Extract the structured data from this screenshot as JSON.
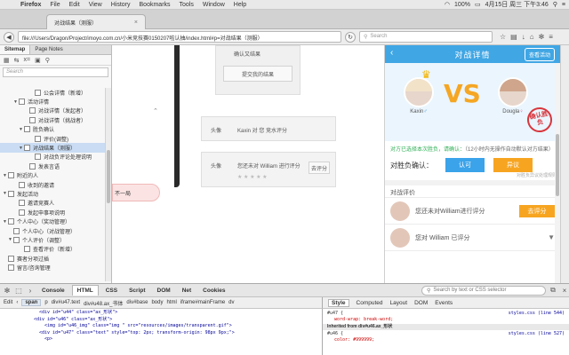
{
  "menubar": {
    "app": "Firefox",
    "items": [
      "File",
      "Edit",
      "View",
      "History",
      "Bookmarks",
      "Tools",
      "Window",
      "Help"
    ],
    "battery": "100%",
    "clock": "4月15日 周三 下午3:46"
  },
  "tab": {
    "title": "对战结果（测服）"
  },
  "nav": {
    "url": "file:///Users/Dragon/Project/imoyo.com.cn/小米竞技赛0150207啦认抽/index.html#p=对战结果（测服）",
    "search_placeholder": "Search"
  },
  "sidebar": {
    "tabs": [
      "Sitemap",
      "Page Notes"
    ],
    "search_placeholder": "Search",
    "tree": [
      {
        "label": "公会详情（新增）",
        "indent": 5,
        "type": "page"
      },
      {
        "label": "活动详情",
        "indent": 2,
        "type": "folder"
      },
      {
        "label": "对战详情（发起者）",
        "indent": 4,
        "type": "page"
      },
      {
        "label": "对战详情（挑战者）",
        "indent": 4,
        "type": "page"
      },
      {
        "label": "胜负确认",
        "indent": 3,
        "type": "folder"
      },
      {
        "label": "评价(调整)",
        "indent": 5,
        "type": "page"
      },
      {
        "label": "对战结果（测服）",
        "indent": 3,
        "type": "folder",
        "selected": true
      },
      {
        "label": "对战负评论处理说明",
        "indent": 5,
        "type": "page"
      },
      {
        "label": "发表言语",
        "indent": 4,
        "type": "page"
      },
      {
        "label": "附近的人",
        "indent": 0,
        "type": "folder"
      },
      {
        "label": "收到的邀请",
        "indent": 2,
        "type": "page"
      },
      {
        "label": "发起活动",
        "indent": 0,
        "type": "folder"
      },
      {
        "label": "邀请竞赛人",
        "indent": 2,
        "type": "page"
      },
      {
        "label": "发起申事项说明",
        "indent": 2,
        "type": "page"
      },
      {
        "label": "个人中心（奖动管理）",
        "indent": 0,
        "type": "folder"
      },
      {
        "label": "个人中心（对战管理）",
        "indent": 1,
        "type": "page"
      },
      {
        "label": "个人评价（调整）",
        "indent": 1,
        "type": "folder"
      },
      {
        "label": "查看评价（新增）",
        "indent": 3,
        "type": "page"
      },
      {
        "label": "赛者分项过插",
        "indent": 0,
        "type": "page"
      },
      {
        "label": "留言/咨询管理",
        "indent": 0,
        "type": "page"
      }
    ]
  },
  "canvas": {
    "top_card_text": "确认又结果",
    "top_card_button": "提交我的结果",
    "row1_label": "头像",
    "row1_text": "Kaxin 对 您 竞水评分",
    "row2_label": "头像",
    "row2_text": "您还未对 William 进行评分",
    "row2_button": "去评分",
    "pink_pill": "不一局"
  },
  "phone": {
    "title": "对战详情",
    "action": "查看活动",
    "player1": {
      "name": "Kaxin",
      "sex": "♂"
    },
    "player2": {
      "name": "Dougla",
      "sex": "♀"
    },
    "vs": "VS",
    "stamp": "确认胜负",
    "notice_green": "对方已选择本次胜负，请确认：",
    "notice_grey": "（12小时内无操作自动默认对方结果）",
    "confirm_label": "对胜负确认：",
    "btn_agree": "认可",
    "btn_dispute": "异议",
    "small_link": "对胜负异议处理规则",
    "eval_title": "对战评价",
    "eval1_text": "您还未对William进行评分",
    "eval1_button": "去评分",
    "eval2_text": "您对 William 已评分",
    "eval2_arrow": "▼"
  },
  "firebug": {
    "tabs": [
      "Console",
      "HTML",
      "CSS",
      "Script",
      "DOM",
      "Net",
      "Cookies"
    ],
    "active_tab": "HTML",
    "search_placeholder": "Search by text or CSS selector",
    "edit_label": "Edit",
    "crumbs": [
      "span",
      "p",
      "div#u47.text",
      "div#u48.ax_书体",
      "div#base",
      "body",
      "html",
      "iframe#mainFrame",
      "dv"
    ],
    "selected_crumb": "span",
    "side_tabs": [
      "Style",
      "Computed",
      "Layout",
      "DOM",
      "Events"
    ],
    "html_lines": [
      "<div id=\"u44\" class=\"ax_形状\">",
      "<div id=\"u46\" class=\"ax_形状\">",
      "<img id=\"u46_img\" class=\"img \" src=\"resources/images/transparent.gif\">",
      "<div id=\"u47\" class=\"text\" style=\"top: 2px; transform-origin: 98px 9px;\">",
      "<p>"
    ],
    "css_rule1_sel": "#u47 {",
    "css_rule1_src": "styles.css (line 544)",
    "css_rule1_prop": "word-wrap: break-word;",
    "css_inherited": "Inherited from div#u46.ax_形状",
    "css_rule2_sel": "#u46 {",
    "css_rule2_src": "styles.css (line 527)",
    "css_rule2_prop": "color: #999999;"
  }
}
